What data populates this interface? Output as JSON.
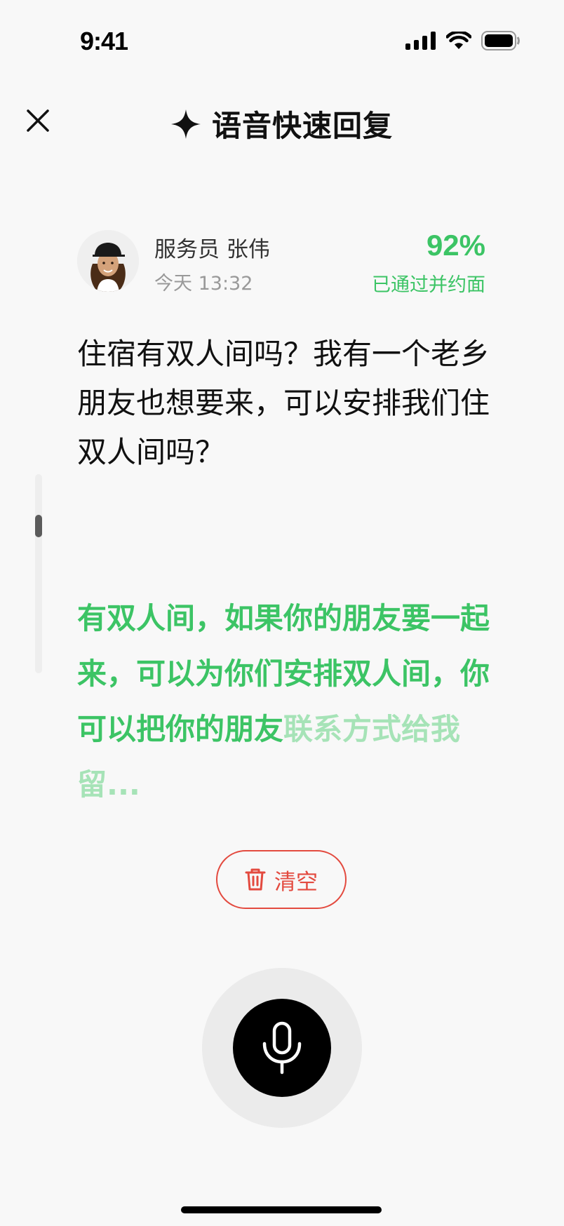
{
  "status_bar": {
    "time": "9:41",
    "icons": [
      "signal-icon",
      "wifi-icon",
      "battery-icon"
    ]
  },
  "header": {
    "close_icon": "close-icon",
    "title_icon": "sparkle-icon",
    "title": "语音快速回复"
  },
  "staff": {
    "name": "服务员 张伟",
    "time": "今天 13:32",
    "score": "92%",
    "score_label": "已通过并约面"
  },
  "question": "住宿有双人间吗？我有一个老乡朋友也想要来，可以安排我们住双人间吗？",
  "answer": {
    "confirmed": "有双人间，如果你的朋友要一起来，可以为你们安排双人间，你可以把你的朋友",
    "pending": "联系方式给我留..."
  },
  "actions": {
    "clear_icon": "trash-icon",
    "clear_label": "清空",
    "mic_icon": "microphone-icon"
  },
  "colors": {
    "accent_green": "#3cc465",
    "faded_green": "#a6e3b7",
    "danger_red": "#e34a3f"
  }
}
